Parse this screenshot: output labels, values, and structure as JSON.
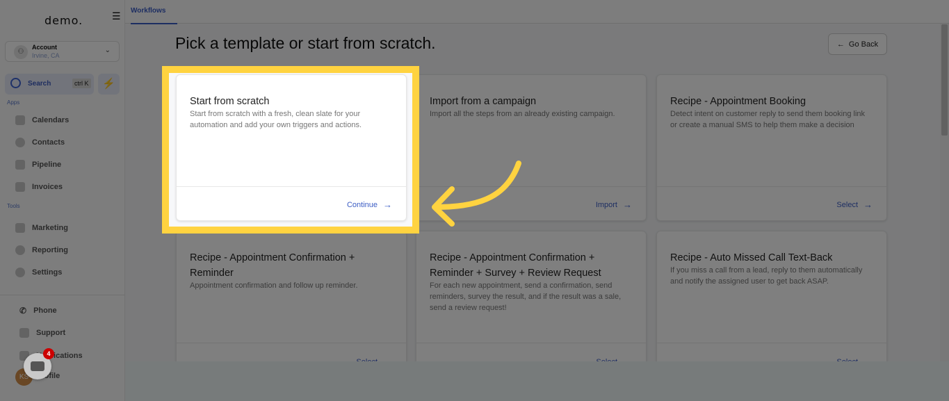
{
  "sidebar": {
    "logo": "demo.",
    "account": {
      "name": "Account",
      "location": "Irvine, CA"
    },
    "search": {
      "label": "Search",
      "shortcut": "ctrl K"
    },
    "sections": {
      "apps": "Apps",
      "tools": "Tools"
    },
    "apps": [
      {
        "label": "Calendars",
        "icon": "calendar-icon"
      },
      {
        "label": "Contacts",
        "icon": "contacts-icon"
      },
      {
        "label": "Pipeline",
        "icon": "pipeline-icon"
      },
      {
        "label": "Invoices",
        "icon": "invoice-icon"
      }
    ],
    "tools": [
      {
        "label": "Marketing",
        "icon": "megaphone-icon"
      },
      {
        "label": "Reporting",
        "icon": "pie-chart-icon"
      },
      {
        "label": "Settings",
        "icon": "gear-icon"
      }
    ],
    "bottom": [
      {
        "label": "Phone",
        "icon": "phone-icon"
      },
      {
        "label": "Support",
        "icon": "chat-icon"
      },
      {
        "label": "Notifications",
        "icon": "bell-icon"
      },
      {
        "label": "Profile",
        "icon": "avatar"
      }
    ],
    "avatar_initials": "KS",
    "chat_badge": "4"
  },
  "tabs": [
    {
      "label": "Workflows",
      "active": true
    }
  ],
  "main": {
    "title": "Pick a template or start from scratch.",
    "go_back": "Go Back",
    "cards": [
      {
        "title": "Start from scratch",
        "desc": "Start from scratch with a fresh, clean slate for your automation and add your own triggers and actions.",
        "action": "Continue"
      },
      {
        "title": "Import from a campaign",
        "desc": "Import all the steps from an already existing campaign.",
        "action": "Import"
      },
      {
        "title": "Recipe - Appointment Booking",
        "desc": "Detect intent on customer reply to send them booking link or create a manual SMS to help them make a decision",
        "action": "Select"
      },
      {
        "title": "Recipe - Appointment Confirmation + Reminder",
        "desc": "Appointment confirmation and follow up reminder.",
        "action": "Select"
      },
      {
        "title": "Recipe - Appointment Confirmation + Reminder + Survey + Review Request",
        "desc": "For each new appointment, send a confirmation, send reminders, survey the result, and if the result was a sale, send a review request!",
        "action": "Select"
      },
      {
        "title": "Recipe - Auto Missed Call Text-Back",
        "desc": "If you miss a call from a lead, reply to them automatically and notify the assigned user to get back ASAP.",
        "action": "Select"
      }
    ]
  },
  "colors": {
    "accent": "#3b5cc4",
    "highlight": "#ffd340"
  }
}
